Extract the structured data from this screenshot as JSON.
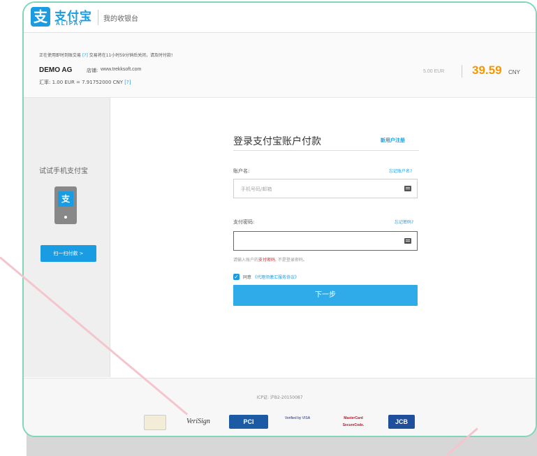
{
  "header": {
    "logo_cn": "支付宝",
    "logo_en": "ALIPAY",
    "logo_badge": "支",
    "cashier": "我的收银台"
  },
  "order": {
    "notice": "正在使用即时到账交易",
    "notice_help": "[?]",
    "notice_tail": "交易将在11小时59分钟后关闭，请及时付款!",
    "merchant": "DEMO AG",
    "shop_label": "店铺:",
    "shop_url": "www.trekksoft.com",
    "rate": "汇率: 1.00 EUR = 7.91752000 CNY",
    "rate_help": "[?]",
    "amount_eur": "5.00 EUR",
    "amount_cny": "39.59",
    "currency": "CNY"
  },
  "sidebar": {
    "title": "试试手机支付宝",
    "phone_badge": "支",
    "scan_button": "扫一扫付款 >"
  },
  "login": {
    "title": "登录支付宝账户付款",
    "register": "新用户注册",
    "account_label": "账户名:",
    "forgot_account": "忘记账户名?",
    "account_placeholder": "手机号码/邮箱",
    "password_label": "支付密码:",
    "forgot_password": "忘记密码?",
    "hint_pre": "请输入账户的",
    "hint_red": "支付密码",
    "hint_post": ", 不是登录密码。",
    "agree_label": "同意",
    "agree_link": "《代理须缴汇服务协议》",
    "next_button": "下一步"
  },
  "footer": {
    "icp": "ICP证: 沪B2-20150087",
    "badges": [
      "VeriSign",
      "PCI",
      "Verified by VISA",
      "MasterCard SecureCode.",
      "JCB"
    ]
  },
  "colors": {
    "brand": "#1a9ce2",
    "amount": "#f39800",
    "frame": "#7fd7b8"
  }
}
